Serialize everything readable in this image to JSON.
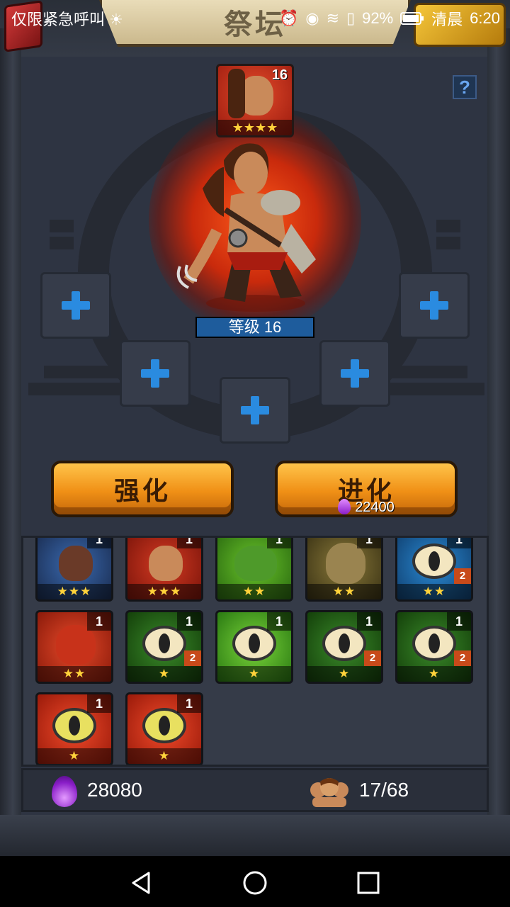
{
  "status_bar": {
    "left_text": "仅限紧急呼叫",
    "battery": "92%",
    "carrier": "清晨",
    "time": "6:20"
  },
  "title": "祭坛",
  "help_label": "?",
  "hero": {
    "card_level": "16",
    "card_stars": "★★★★",
    "level_label": "等级 16"
  },
  "buttons": {
    "enhance_label": "强化",
    "evolve_label": "进化",
    "evolve_cost": "22400"
  },
  "inventory": {
    "units": [
      {
        "level": "1",
        "stars": "★★★",
        "badge": ""
      },
      {
        "level": "1",
        "stars": "★★★",
        "badge": ""
      },
      {
        "level": "1",
        "stars": "★★",
        "badge": ""
      },
      {
        "level": "1",
        "stars": "★★",
        "badge": ""
      },
      {
        "level": "1",
        "stars": "★★",
        "badge": "2"
      },
      {
        "level": "1",
        "stars": "★★",
        "badge": ""
      },
      {
        "level": "1",
        "stars": "★",
        "badge": "2"
      },
      {
        "level": "1",
        "stars": "★",
        "badge": ""
      },
      {
        "level": "1",
        "stars": "★",
        "badge": "2"
      },
      {
        "level": "1",
        "stars": "★",
        "badge": "2"
      },
      {
        "level": "1",
        "stars": "★",
        "badge": ""
      },
      {
        "level": "1",
        "stars": "★",
        "badge": ""
      }
    ]
  },
  "footer": {
    "essence": "28080",
    "unit_capacity": "17/68"
  },
  "icons": [
    "warning-sun-icon",
    "alarm-icon",
    "eye-icon",
    "wifi-icon",
    "sim-icon",
    "battery-icon",
    "help-icon",
    "plus-icon",
    "flame-icon",
    "essence-icon",
    "units-icon",
    "back-icon",
    "home-icon",
    "recents-icon"
  ],
  "colors": {
    "accent_orange": "#f09016",
    "slot_plus_blue": "#2a8be0",
    "star_gold": "#ffd23a",
    "essence_purple": "#8a1ec8"
  }
}
